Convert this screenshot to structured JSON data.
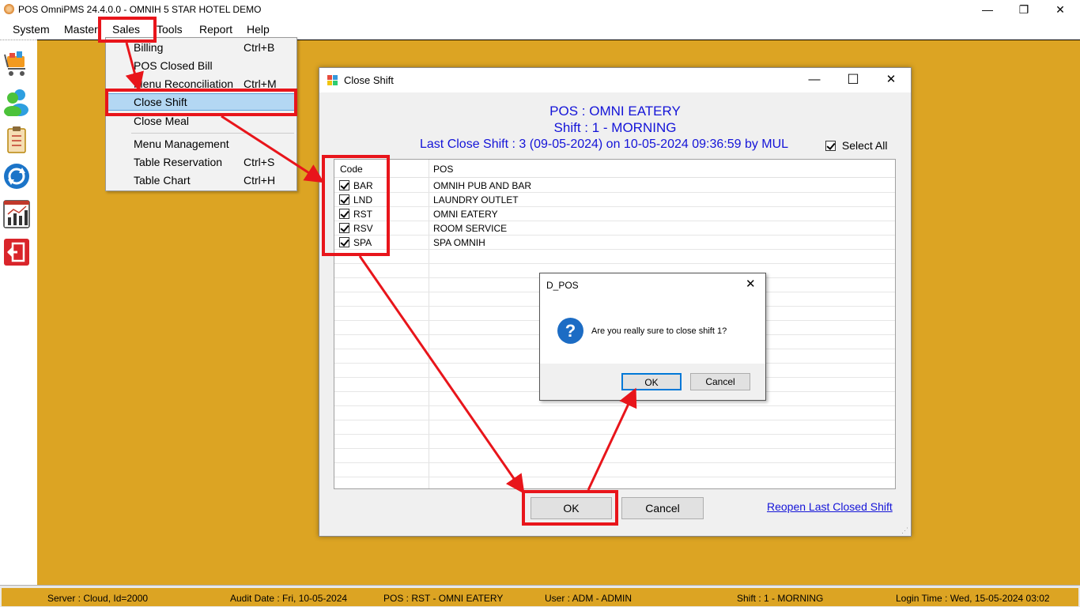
{
  "app": {
    "title": "POS OmniPMS 24.4.0.0 - OMNIH 5 STAR HOTEL DEMO",
    "min_icon": "—",
    "restore_icon": "❐",
    "close_icon": "✕"
  },
  "menubar": {
    "items": [
      "System",
      "Master",
      "Sales",
      "Tools",
      "Report",
      "Help"
    ]
  },
  "sales_menu": {
    "items": [
      {
        "label": "Billing",
        "shortcut": "Ctrl+B"
      },
      {
        "label": "POS Closed Bill",
        "shortcut": ""
      },
      {
        "label": "Menu Reconciliation",
        "shortcut": "Ctrl+M"
      },
      {
        "label": "Close Shift",
        "shortcut": ""
      },
      {
        "label": "Close Meal",
        "shortcut": ""
      },
      {
        "label": "Menu Management",
        "shortcut": ""
      },
      {
        "label": "Table Reservation",
        "shortcut": "Ctrl+S"
      },
      {
        "label": "Table Chart",
        "shortcut": "Ctrl+H"
      }
    ]
  },
  "close_shift": {
    "title": "Close Shift",
    "pos_line": "POS : OMNI EATERY",
    "shift_line": "Shift : 1 - MORNING",
    "last_close": "Last Close Shift : 3 (09-05-2024) on 10-05-2024 09:36:59 by MUL",
    "select_all": "Select All",
    "columns": [
      "Code",
      "POS"
    ],
    "rows": [
      {
        "code": "BAR",
        "pos": "OMNIH PUB AND BAR"
      },
      {
        "code": "LND",
        "pos": "LAUNDRY OUTLET"
      },
      {
        "code": "RST",
        "pos": "OMNI EATERY"
      },
      {
        "code": "RSV",
        "pos": "ROOM SERVICE"
      },
      {
        "code": "SPA",
        "pos": "SPA OMNIH"
      }
    ],
    "ok_label": "OK",
    "cancel_label": "Cancel",
    "reopen_label": "Reopen Last Closed Shift"
  },
  "dialog": {
    "title": "D_POS",
    "message": "Are you really sure to close shift 1?",
    "ok_label": "OK",
    "cancel_label": "Cancel"
  },
  "statusbar": {
    "server": "Server : Cloud, Id=2000",
    "audit_date": "Audit Date : Fri, 10-05-2024",
    "pos": "POS : RST - OMNI EATERY",
    "user": "User : ADM - ADMIN",
    "shift": "Shift : 1 - MORNING",
    "login_time": "Login Time : Wed, 15-05-2024 03:02"
  },
  "colors": {
    "workspace": "#dca423",
    "annotation_red": "#e8151b",
    "heading_blue": "#1414d8",
    "menu_highlight": "#b3d7f3"
  }
}
